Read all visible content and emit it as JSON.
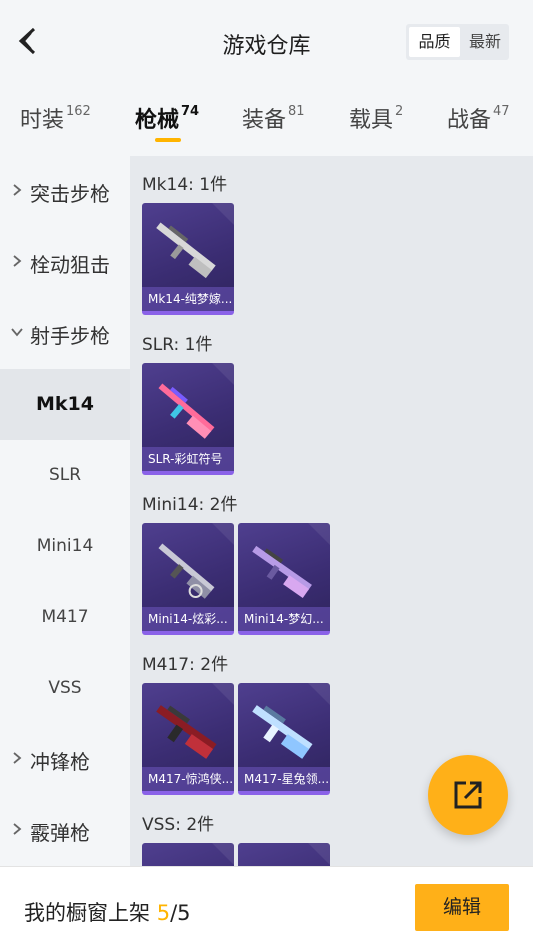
{
  "header": {
    "title": "游戏仓库",
    "sort_active": "品质",
    "sort_other": "最新"
  },
  "tabs": [
    {
      "label": "时装",
      "count": "162"
    },
    {
      "label": "枪械",
      "count": "74"
    },
    {
      "label": "装备",
      "count": "81"
    },
    {
      "label": "载具",
      "count": "2"
    },
    {
      "label": "战备",
      "count": "47"
    }
  ],
  "sidebar": {
    "categories": [
      "突击步枪",
      "栓动狙击",
      "射手步枪",
      "冲锋枪",
      "霰弹枪"
    ],
    "subitems": [
      "Mk14",
      "SLR",
      "Mini14",
      "M417",
      "VSS"
    ]
  },
  "groups": [
    {
      "title": "Mk14: 1件",
      "items": [
        "Mk14-纯梦嫁..."
      ]
    },
    {
      "title": "SLR: 1件",
      "items": [
        "SLR-彩虹符号"
      ]
    },
    {
      "title": "Mini14: 2件",
      "items": [
        "Mini14-炫彩...",
        "Mini14-梦幻..."
      ]
    },
    {
      "title": "M417: 2件",
      "items": [
        "M417-惊鸿侠...",
        "M417-星兔领..."
      ]
    },
    {
      "title": "VSS: 2件",
      "items": [
        "",
        ""
      ]
    }
  ],
  "bottom": {
    "label": "我的橱窗上架",
    "current": "5",
    "separator": "/",
    "total": "5",
    "edit_label": "编辑"
  },
  "colors": {
    "accent": "#ffb018",
    "item_bg": "#3b2d73",
    "item_border": "#8a62e8"
  }
}
